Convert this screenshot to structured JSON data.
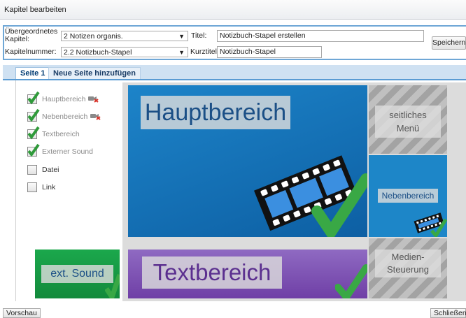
{
  "window": {
    "title": "Kapitel bearbeiten"
  },
  "form": {
    "parent_label": "Übergeordnetes Kapitel:",
    "parent_value": "2 Notizen organis.",
    "title_label": "Titel:",
    "title_value": "Notizbuch-Stapel erstellen",
    "number_label": "Kapitelnummer:",
    "number_value": "2.2 Notizbuch-Stapel",
    "short_label": "Kurztitel:",
    "short_value": "Notizbuch-Stapel",
    "save_label": "Speichern"
  },
  "tabs": [
    {
      "label": "Seite 1",
      "active": true
    },
    {
      "label": "Neue Seite hinzufügen",
      "active": false
    }
  ],
  "checkboxes": [
    {
      "label": "Hauptbereich",
      "checked": true,
      "camera_icon": true
    },
    {
      "label": "Nebenbereich",
      "checked": true,
      "camera_icon": true
    },
    {
      "label": "Textbereich",
      "checked": true,
      "camera_icon": false
    },
    {
      "label": "Externer Sound",
      "checked": true,
      "camera_icon": false
    },
    {
      "label": "Datei",
      "checked": false,
      "camera_icon": false
    },
    {
      "label": "Link",
      "checked": false,
      "camera_icon": false
    }
  ],
  "layout_preview": {
    "haupt": "Hauptbereich",
    "seit_line1": "seitliches",
    "seit_line2": "Menü",
    "neben": "Nebenbereich",
    "medien_line1": "Medien-",
    "medien_line2": "Steuerung",
    "text": "Textbereich",
    "ext": "ext. Sound"
  },
  "footer": {
    "preview_label": "Vorschau",
    "close_label": "Schließen"
  },
  "colors": {
    "accent": "#5a9bd3",
    "check_green": "#2f9a3a",
    "main_blue": "#1d84c9",
    "text_purple": "#7b52b3",
    "sound_green": "#1ba84c"
  }
}
